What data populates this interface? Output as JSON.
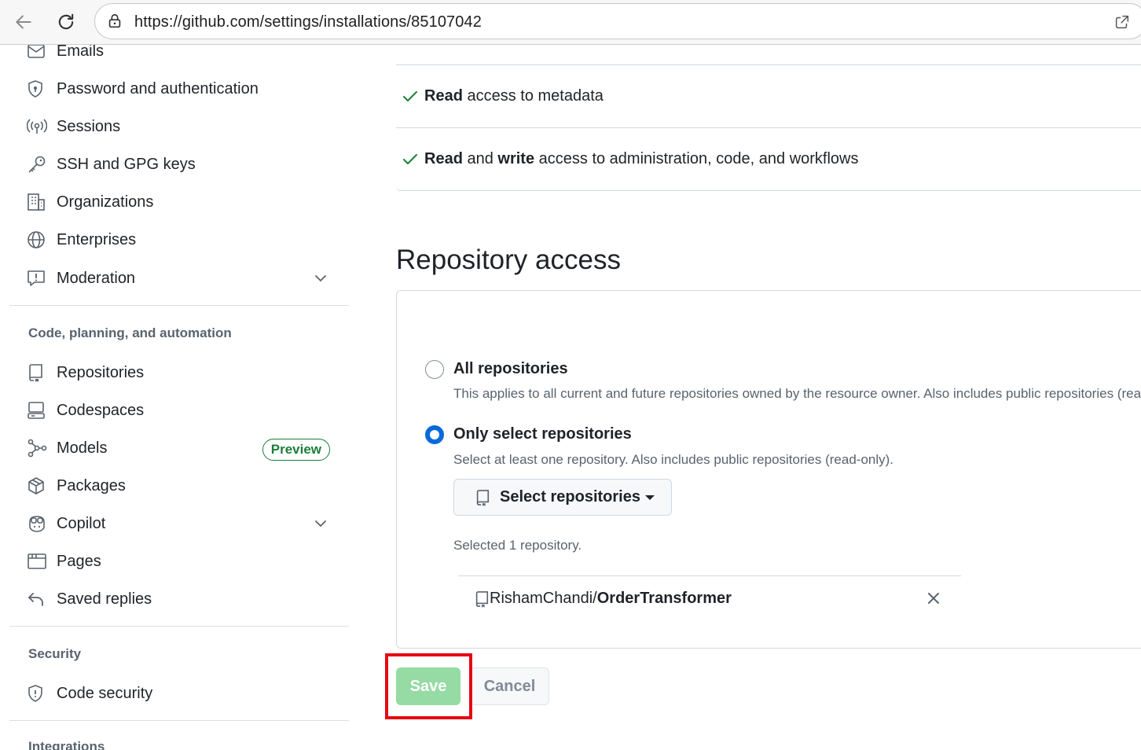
{
  "browser": {
    "url": "https://github.com/settings/installations/85107042"
  },
  "sidebar": {
    "items_top": [
      {
        "label": "Emails",
        "icon": "mail-icon"
      },
      {
        "label": "Password and authentication",
        "icon": "shield-lock-icon"
      },
      {
        "label": "Sessions",
        "icon": "broadcast-icon"
      },
      {
        "label": "SSH and GPG keys",
        "icon": "key-icon"
      },
      {
        "label": "Organizations",
        "icon": "organization-icon"
      },
      {
        "label": "Enterprises",
        "icon": "globe-icon"
      },
      {
        "label": "Moderation",
        "icon": "report-icon"
      }
    ],
    "section_code": "Code, planning, and automation",
    "items_code": [
      {
        "label": "Repositories",
        "icon": "repo-icon"
      },
      {
        "label": "Codespaces",
        "icon": "codespaces-icon"
      },
      {
        "label": "Models",
        "icon": "models-icon",
        "badge": "Preview"
      },
      {
        "label": "Packages",
        "icon": "package-icon"
      },
      {
        "label": "Copilot",
        "icon": "copilot-icon"
      },
      {
        "label": "Pages",
        "icon": "browser-icon"
      },
      {
        "label": "Saved replies",
        "icon": "reply-icon"
      }
    ],
    "section_security": "Security",
    "items_security": [
      {
        "label": "Code security",
        "icon": "shield-icon"
      }
    ],
    "section_integrations": "Integrations"
  },
  "main": {
    "permissions": [
      {
        "strong1": "Read",
        "rest1": " access to metadata",
        "strong2": "",
        "rest2": ""
      },
      {
        "strong1": "Read",
        "rest1": " and ",
        "strong2": "write",
        "rest2": " access to administration, code, and workflows"
      }
    ],
    "repo_access_title": "Repository access",
    "option_all": {
      "title": "All repositories",
      "desc": "This applies to all current and future repositories owned by the resource owner. Also includes public repositories (read-only).",
      "selected": false
    },
    "option_select": {
      "title": "Only select repositories",
      "desc": "Select at least one repository. Also includes public repositories (read-only).",
      "selected": true
    },
    "select_button": "Select repositories",
    "selected_count": "Selected 1 repository.",
    "selected_repo": {
      "owner": "RishamChandi/",
      "name": "OrderTransformer"
    },
    "save_label": "Save",
    "cancel_label": "Cancel",
    "colors": {
      "accent": "#0969da",
      "save_disabled": "#95dba3",
      "highlight": "#e50914",
      "success": "#1a7f37"
    }
  }
}
